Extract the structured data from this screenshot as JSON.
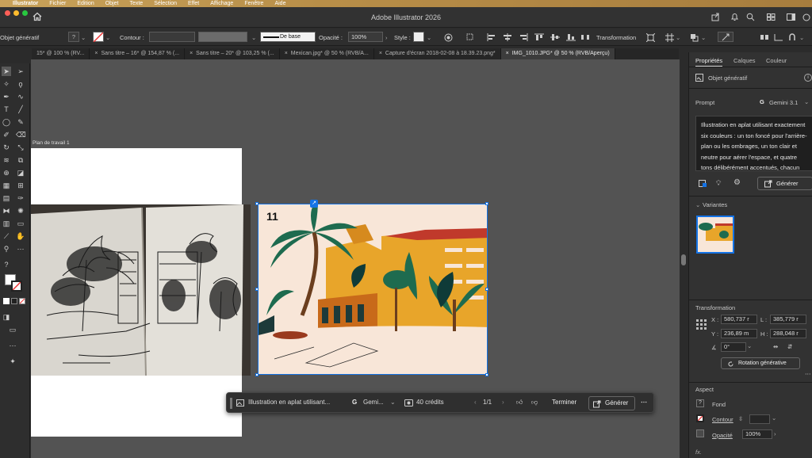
{
  "menubar": [
    "Illustrator",
    "Fichier",
    "Edition",
    "Objet",
    "Texte",
    "Sélection",
    "Effet",
    "Affichage",
    "Fenêtre",
    "Aide"
  ],
  "window": {
    "title": "Adobe Illustrator 2026"
  },
  "control": {
    "object_label": "Objet génératif",
    "stroke_label": "Contour :",
    "brush_label": "De base",
    "opacity_label": "Opacité :",
    "opacity_value": "100%",
    "style_label": "Style :",
    "transform_label": "Transformation"
  },
  "tabs": [
    {
      "label": "15* @ 100 % (RV...",
      "active": false
    },
    {
      "label": "Sans titre – 16* @ 154,87 % (...",
      "active": false
    },
    {
      "label": "Sans titre – 20* @ 103,25 % (...",
      "active": false
    },
    {
      "label": "Mexican.jpg* @ 50 % (RVB/A...",
      "active": false
    },
    {
      "label": "Capture d'écran 2018-02-08 à 18.39.23.png*",
      "active": false
    },
    {
      "label": "IMG_1010.JPG* @ 50 % (RVB/Aperçu)",
      "active": true
    }
  ],
  "canvas": {
    "artboard_label": "Plan de travail 1",
    "art_number": "11"
  },
  "panel": {
    "tabs": [
      "Propriétés",
      "Calques",
      "Couleur"
    ],
    "object_type": "Objet génératif",
    "prompt_label": "Prompt",
    "model": "Gemini 3.1",
    "prompt_text": "Illustration en aplat utilisant exactement six couleurs : un ton foncé pour l'arrière-plan ou les ombrages, un ton clair et neutre pour aérer l'espace, et quatre tons délibérément accentués, chacun attribué à",
    "generate_label": "Générer",
    "variants_label": "Variantes",
    "transform_label": "Transformation",
    "x_label": "X :",
    "x_value": "580,737 r",
    "y_label": "Y :",
    "y_value": "236,89 m",
    "w_label": "L :",
    "w_value": "385,779 r",
    "h_label": "H :",
    "h_value": "288,048 r",
    "angle_value": "0°",
    "gen_rotation_label": "Rotation générative",
    "aspect_label": "Aspect",
    "fill_label": "Fond",
    "stroke_label": "Contour",
    "opacity_label": "Opacité",
    "opacity_value": "100%"
  },
  "context": {
    "prompt_preview": "Illustration en aplat utilisant...",
    "model_short": "Gemi...",
    "credits": "40 crédits",
    "page": "1/1",
    "done_label": "Terminer",
    "generate_label": "Générer"
  },
  "colors": {
    "accent": "#1473e6",
    "bg": "#535353",
    "panel": "#323232"
  }
}
